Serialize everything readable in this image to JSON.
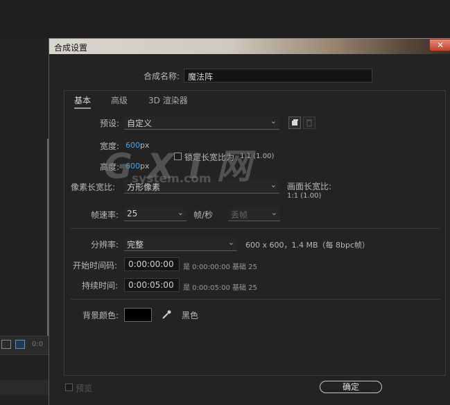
{
  "background": {
    "timeline_text": "0:0"
  },
  "dialog": {
    "title": "合成设置",
    "close_glyph": "✕",
    "name_label": "合成名称:",
    "name_value": "魔法阵",
    "tabs": [
      {
        "label": "基本",
        "active": true
      },
      {
        "label": "高级",
        "active": false
      },
      {
        "label": "3D 渲染器",
        "active": false
      }
    ],
    "preset_label": "预设:",
    "preset_value": "自定义",
    "width_label": "宽度:",
    "width_value": "600",
    "width_unit": "px",
    "height_label": "高度:",
    "height_value": "600",
    "height_unit": "px",
    "lock_aspect_label": "锁定长宽比为",
    "lock_aspect_ratio": "1:1 (1.00)",
    "pixel_aspect_label": "像素长宽比:",
    "pixel_aspect_value": "方形像素",
    "frame_aspect_label": "画面长宽比:",
    "frame_aspect_value": "1:1 (1.00)",
    "frame_rate_label": "帧速率:",
    "frame_rate_value": "25",
    "frame_rate_unit": "帧/秒",
    "frame_rate_mode": "丢帧",
    "resolution_label": "分辨率:",
    "resolution_value": "完整",
    "resolution_info": "600 x 600，1.4 MB（每 8bpc帧）",
    "start_timecode_label": "开始时间码:",
    "start_timecode_value": "0:00:00:00",
    "start_timecode_info": "是 0:00:00:00  基础 25",
    "duration_label": "持续时间:",
    "duration_value": "0:00:05:00",
    "duration_info": "是 0:00:05:00  基础 25",
    "bg_color_label": "背景颜色:",
    "bg_color_name": "黑色",
    "bg_color_hex": "#000000",
    "preview_label": "预览",
    "ok_label": "确定"
  },
  "watermark": {
    "big": "G X I 网",
    "small": "system.com"
  },
  "icons": {
    "dropdown": "chevron-down-icon",
    "new_preset": "save-preset-icon",
    "delete_preset": "trash-icon",
    "eyedropper": "eyedropper-icon",
    "close": "close-icon"
  }
}
